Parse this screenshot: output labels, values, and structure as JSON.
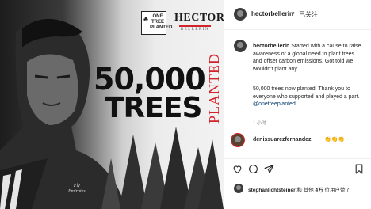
{
  "post_image": {
    "logo_text": [
      "ONE",
      "TREE",
      "PLANTED"
    ],
    "brand_name": "HECTOR",
    "brand_sub": "BELLERIN",
    "headline_number": "50,000",
    "headline_word": "TREES",
    "headline_vertical": "PLANTED",
    "shirt_text": [
      "Fly",
      "Emirates"
    ]
  },
  "header": {
    "username": "hectorbellerin",
    "separator": "•",
    "follow_label": "已关注"
  },
  "caption": {
    "username": "hectorbellerin",
    "text": "Started with a cause to raise awareness of a global need to plant trees and offset carbon emissions. Got told we wouldn't plant any...",
    "text2_prefix": "50,000 trees now planted. Thank you to everyone who supported and played a part. ",
    "tag": "@onetreeplanted",
    "time": "1 小时"
  },
  "comment": {
    "username": "denissuarezfernandez",
    "text": "👏👏👏"
  },
  "actions": {
    "icons": [
      "heart-icon",
      "comment-icon",
      "share-icon",
      "bookmark-icon"
    ]
  },
  "likes": {
    "user": "stephanlichtsteiner",
    "middle": " 和 其他 ",
    "count": "4万",
    "suffix": " 位用户赞了"
  }
}
